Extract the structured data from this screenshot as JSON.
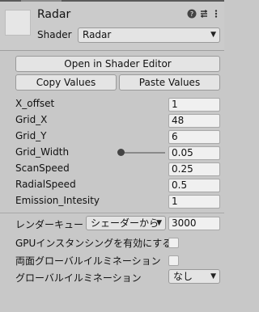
{
  "header": {
    "title": "Radar",
    "shader_label": "Shader",
    "shader_value": "Radar",
    "icons": [
      "help-icon",
      "preset-icon",
      "more-icon"
    ]
  },
  "buttons": {
    "open_shader_editor": "Open in Shader Editor",
    "copy_values": "Copy Values",
    "paste_values": "Paste Values"
  },
  "properties": [
    {
      "label": "X_offset",
      "value": "1"
    },
    {
      "label": "Grid_X",
      "value": "48"
    },
    {
      "label": "Grid_Y",
      "value": "6"
    },
    {
      "label": "Grid_Width",
      "value": "0.05",
      "slider": true
    },
    {
      "label": "ScanSpeed",
      "value": "0.25"
    },
    {
      "label": "RadialSpeed",
      "value": "0.5"
    },
    {
      "label": "Emission_Intesity",
      "value": "1"
    }
  ],
  "render_queue": {
    "label": "レンダーキュー",
    "mode": "シェーダーから",
    "value": "3000"
  },
  "options": {
    "gpu_instancing_label": "GPUインスタンシングを有効にする",
    "gpu_instancing_checked": false,
    "double_sided_gi_label": "両面グローバルイルミネーション",
    "double_sided_gi_checked": false,
    "global_illumination_label": "グローバルイルミネーション",
    "global_illumination_value": "なし"
  }
}
